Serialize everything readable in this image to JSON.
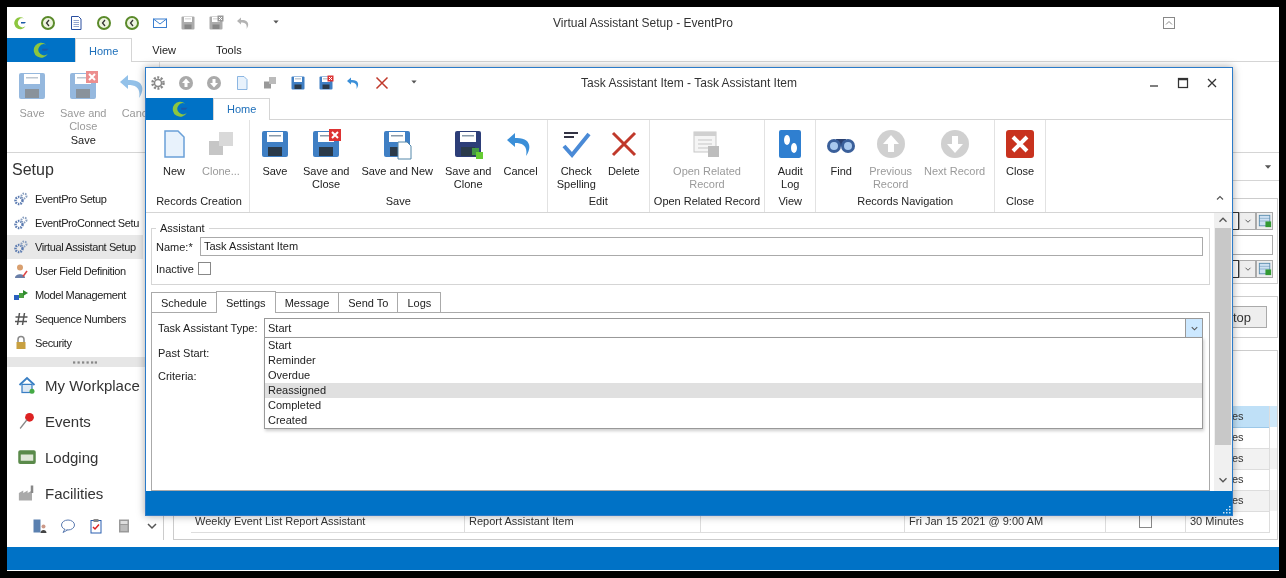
{
  "window": {
    "title": "Virtual Assistant Setup - EventPro"
  },
  "ribbon": {
    "tabs": [
      {
        "label": "Home",
        "selected": true
      },
      {
        "label": "View",
        "selected": false
      },
      {
        "label": "Tools",
        "selected": false
      }
    ],
    "groups": [
      {
        "label": "Save",
        "buttons": [
          {
            "label": "Save",
            "kind": "save",
            "disabled": true
          },
          {
            "label": "Save and\nClose",
            "kind": "save-close",
            "disabled": true
          },
          {
            "label": "Canc",
            "kind": "undo",
            "disabled": true
          }
        ]
      }
    ]
  },
  "sidebar": {
    "header": "Setup",
    "items": [
      {
        "label": "EventPro Setup",
        "kind": "gears",
        "selected": false
      },
      {
        "label": "EventProConnect Setu",
        "kind": "gears",
        "selected": false
      },
      {
        "label": "Virtual Assistant Setup",
        "kind": "gears",
        "selected": true
      },
      {
        "label": "User Field Definition",
        "kind": "person",
        "selected": false
      },
      {
        "label": "Model Management",
        "kind": "blocks",
        "selected": false
      },
      {
        "label": "Sequence Numbers",
        "kind": "hash",
        "selected": false
      },
      {
        "label": "Security",
        "kind": "lock",
        "selected": false
      }
    ],
    "nav": [
      {
        "label": "My Workplace",
        "kind": "house"
      },
      {
        "label": "Events",
        "kind": "pin"
      },
      {
        "label": "Lodging",
        "kind": "bed"
      },
      {
        "label": "Facilities",
        "kind": "factory"
      }
    ]
  },
  "workspace": {
    "button": "top",
    "grid": {
      "rows": [
        {
          "kind": "partial",
          "selected": true,
          "column_6": "es"
        },
        {
          "kind": "partial",
          "selected": false,
          "column_6": "es"
        },
        {
          "kind": "partial",
          "selected": false,
          "column_6": "es"
        },
        {
          "kind": "partial",
          "selected": false,
          "column_6": "es"
        },
        {
          "kind": "partial",
          "selected": false,
          "column_6": "es"
        },
        {
          "kind": "full",
          "selected": false,
          "column_1": "Weekly Event List Report Assistant",
          "column_2": "Report Assistant Item",
          "column_4": "Fri Jan 15 2021 @ 9:00 AM",
          "checked": false,
          "column_6": "30 Minutes"
        }
      ]
    }
  },
  "dialog": {
    "title": "Task Assistant Item - Task Assistant Item",
    "tabs": [
      {
        "label": "Home",
        "selected": true
      }
    ],
    "groups": [
      {
        "label": "Records Creation",
        "buttons": [
          {
            "label": "New",
            "kind": "new",
            "disabled": false
          },
          {
            "label": "Clone...",
            "kind": "clone",
            "disabled": true
          }
        ]
      },
      {
        "label": "Save",
        "buttons": [
          {
            "label": "Save",
            "kind": "save",
            "disabled": false
          },
          {
            "label": "Save and\nClose",
            "kind": "save-close",
            "disabled": false
          },
          {
            "label": "Save and New",
            "kind": "save-new",
            "disabled": false
          },
          {
            "label": "Save and\nClone",
            "kind": "save-clone",
            "disabled": false
          },
          {
            "label": "Cancel",
            "kind": "undo",
            "disabled": false
          }
        ]
      },
      {
        "label": "Edit",
        "buttons": [
          {
            "label": "Check\nSpelling",
            "kind": "spell",
            "disabled": false
          },
          {
            "label": "Delete",
            "kind": "delete",
            "disabled": false
          }
        ]
      },
      {
        "label": "Open Related Record",
        "buttons": [
          {
            "label": "Open Related\nRecord",
            "kind": "related",
            "disabled": true
          }
        ]
      },
      {
        "label": "View",
        "buttons": [
          {
            "label": "Audit\nLog",
            "kind": "audit",
            "disabled": false
          }
        ]
      },
      {
        "label": "Records Navigation",
        "buttons": [
          {
            "label": "Find",
            "kind": "find",
            "disabled": false
          },
          {
            "label": "Previous\nRecord",
            "kind": "up",
            "disabled": true
          },
          {
            "label": "Next Record",
            "kind": "down",
            "disabled": true
          }
        ]
      },
      {
        "label": "Close",
        "buttons": [
          {
            "label": "Close",
            "kind": "close",
            "disabled": false
          }
        ]
      }
    ],
    "assistant": {
      "legend": "Assistant",
      "name_label": "Name:*",
      "name_value": "Task Assistant Item",
      "inactive_label": "Inactive",
      "inactive_checked": false
    },
    "form_tabs": [
      {
        "label": "Schedule",
        "selected": false
      },
      {
        "label": "Settings",
        "selected": true
      },
      {
        "label": "Message",
        "selected": false
      },
      {
        "label": "Send To",
        "selected": false
      },
      {
        "label": "Logs",
        "selected": false
      }
    ],
    "settings": {
      "type_label": "Task Assistant Type:",
      "type_value": "Start",
      "past_start_label": "Past Start:",
      "criteria_label": "Criteria:",
      "options": [
        {
          "label": "Start",
          "selected": false
        },
        {
          "label": "Reminder",
          "selected": false
        },
        {
          "label": "Overdue",
          "selected": false
        },
        {
          "label": "Reassigned",
          "selected": true
        },
        {
          "label": "Completed",
          "selected": false
        },
        {
          "label": "Created",
          "selected": false
        }
      ]
    }
  }
}
